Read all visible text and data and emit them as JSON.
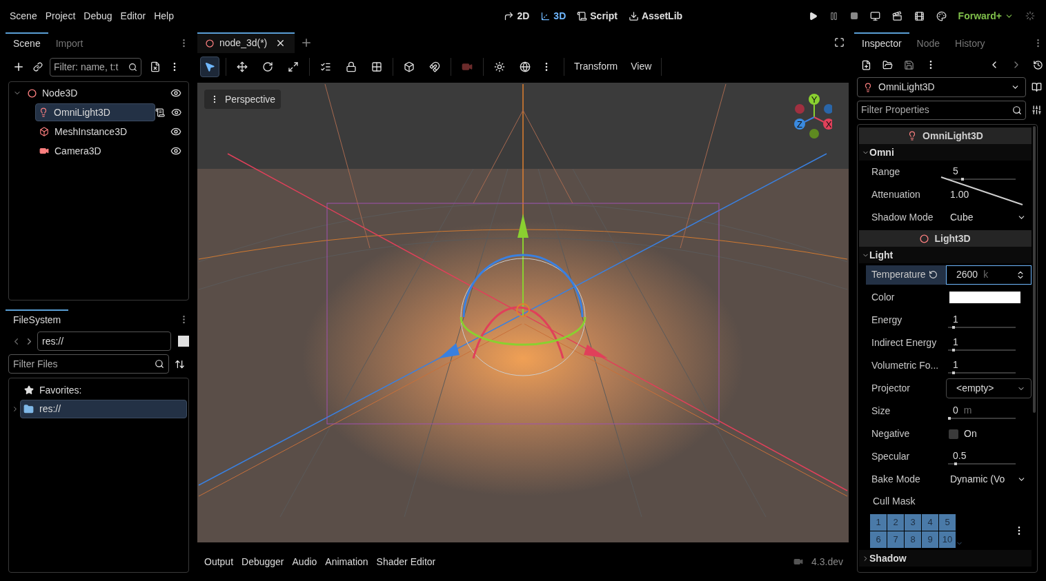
{
  "menu": [
    "Scene",
    "Project",
    "Debug",
    "Editor",
    "Help"
  ],
  "workspaces": [
    {
      "kind": "flat",
      "label": "2D",
      "selected": false
    },
    {
      "kind": "spatial",
      "label": "3D",
      "selected": true
    },
    {
      "kind": "script",
      "label": "Script",
      "selected": false
    },
    {
      "kind": "assetlib",
      "label": "AssetLib",
      "selected": false
    }
  ],
  "renderer": "Forward+",
  "scene_dock": {
    "tabs": [
      {
        "label": "Scene",
        "selected": true
      },
      {
        "label": "Import",
        "selected": false
      }
    ],
    "filter_placeholder": "Filter: name, t:t",
    "tree": [
      {
        "name": "Node3D",
        "kind": "node",
        "expanded": true,
        "selected": false,
        "has_script": false,
        "children": [
          {
            "name": "OmniLight3D",
            "kind": "light",
            "selected": true,
            "has_script": true
          },
          {
            "name": "MeshInstance3D",
            "kind": "mesh",
            "selected": false,
            "has_script": false
          },
          {
            "name": "Camera3D",
            "kind": "camera",
            "selected": false,
            "has_script": false
          }
        ]
      }
    ]
  },
  "filesystem": {
    "tab": "FileSystem",
    "path": "res://",
    "filter_placeholder": "Filter Files",
    "favorites": "Favorites:",
    "items": [
      {
        "name": "res://",
        "expanded": false,
        "selected": true
      }
    ]
  },
  "editor_tabs": [
    {
      "label": "node_3d(*)",
      "selected": true
    }
  ],
  "viewport_toolbar": {
    "tools": [
      {
        "kind": "select",
        "selected": true
      },
      {
        "kind": "move",
        "selected": false
      },
      {
        "kind": "rotate",
        "selected": false
      },
      {
        "kind": "scale",
        "selected": false
      },
      {
        "kind": "list",
        "selected": false
      },
      {
        "kind": "lock",
        "selected": false
      },
      {
        "kind": "group",
        "selected": false
      },
      {
        "kind": "local",
        "selected": false
      },
      {
        "kind": "snap",
        "selected": false
      },
      {
        "kind": "preview",
        "selected": false
      },
      {
        "kind": "sun",
        "selected": false
      },
      {
        "kind": "environment",
        "selected": false
      }
    ],
    "menus": [
      "Transform",
      "View"
    ]
  },
  "viewport": {
    "view_menu": "Perspective",
    "gizmo_labels": [
      "Y",
      "Z",
      "X"
    ]
  },
  "bottom_panel": {
    "tabs": [
      "Output",
      "Debugger",
      "Audio",
      "Animation",
      "Shader Editor"
    ],
    "version": "4.3.dev"
  },
  "inspector": {
    "tabs": [
      {
        "label": "Inspector",
        "selected": true
      },
      {
        "label": "Node",
        "selected": false
      },
      {
        "label": "History",
        "selected": false
      }
    ],
    "node": "OmniLight3D",
    "filter_placeholder": "Filter Properties",
    "rows": [
      {
        "kind": "class",
        "label": "OmniLight3D"
      },
      {
        "kind": "group",
        "label": "Omni",
        "expanded": true
      },
      {
        "kind": "slider",
        "label": "Range",
        "value": "5",
        "level": 0.2
      },
      {
        "kind": "curve",
        "label": "Attenuation",
        "value": "1.00"
      },
      {
        "kind": "dropdown",
        "label": "Shadow Mode",
        "value": "Cube"
      },
      {
        "kind": "class",
        "label": "Light3D"
      },
      {
        "kind": "group",
        "label": "Light",
        "expanded": true
      },
      {
        "kind": "spin",
        "label": "Temperature",
        "value": "2600",
        "unit": "k",
        "selected": true
      },
      {
        "kind": "color",
        "label": "Color",
        "color": "#ffffff"
      },
      {
        "kind": "slider",
        "label": "Energy",
        "value": "1",
        "level": 0.06
      },
      {
        "kind": "slider",
        "label": "Indirect Energy",
        "value": "1",
        "level": 0.06
      },
      {
        "kind": "slider",
        "label": "Volumetric Fo...",
        "value": "1",
        "level": 0.06
      },
      {
        "kind": "picker",
        "label": "Projector",
        "value": "<empty>"
      },
      {
        "kind": "slider",
        "label": "Size",
        "value": "0",
        "unit": "m",
        "level": 0
      },
      {
        "kind": "checkbox",
        "label": "Negative",
        "value": "On",
        "checked": false
      },
      {
        "kind": "slider",
        "label": "Specular",
        "value": "0.5",
        "level": 0.1
      },
      {
        "kind": "dropdown",
        "label": "Bake Mode",
        "value": "Dynamic (Vo"
      },
      {
        "kind": "label",
        "label": "Cull Mask"
      },
      {
        "kind": "mask",
        "cells": [
          {
            "label": "1",
            "on": true
          },
          {
            "label": "2",
            "on": true
          },
          {
            "label": "3",
            "on": true
          },
          {
            "label": "4",
            "on": true
          },
          {
            "label": "5",
            "on": true
          },
          {
            "label": "6",
            "on": true
          },
          {
            "label": "7",
            "on": true
          },
          {
            "label": "8",
            "on": true
          },
          {
            "label": "9",
            "on": true
          },
          {
            "label": "10",
            "on": true
          }
        ]
      },
      {
        "kind": "group",
        "label": "Shadow",
        "expanded": false
      }
    ]
  }
}
